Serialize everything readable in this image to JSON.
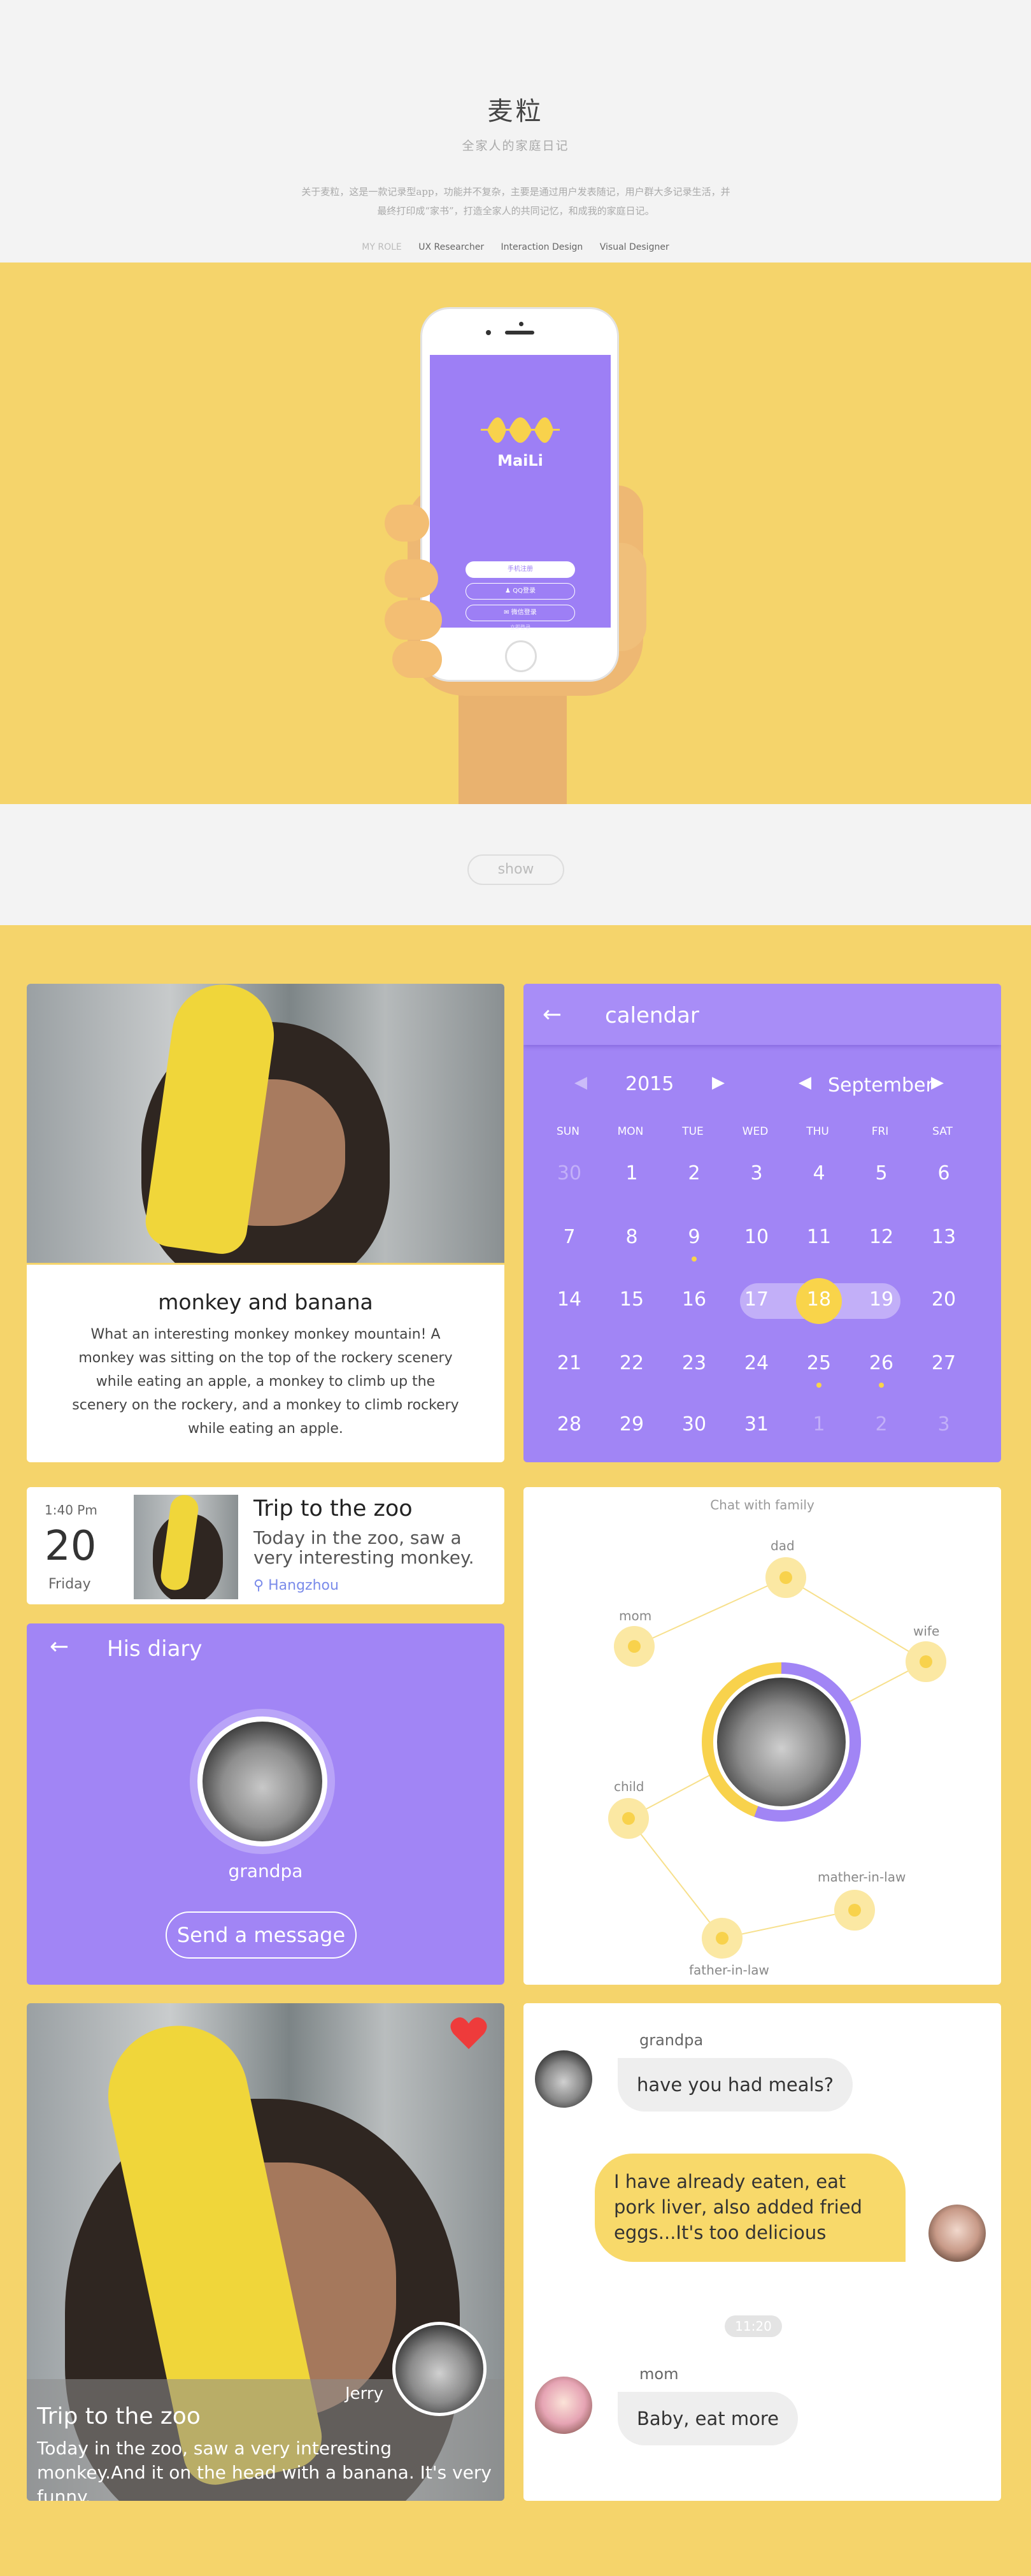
{
  "header": {
    "title": "麦粒",
    "subtitle": "全家人的家庭日记",
    "description": "关于麦粒，这是一款记录型app，功能并不复杂，主要是通过用户发表随记，用户群大多记录生活，并最终打印成“家书”，打造全家人的共同记忆，和成我的家庭日记。",
    "roles_label": "MY ROLE",
    "roles": [
      "UX Researcher",
      "Interaction Design",
      "Visual Designer"
    ]
  },
  "phone": {
    "app_name": "MaiLi",
    "phone_login": "手机注册",
    "qq_login": "QQ登录",
    "wechat_login": "微信登录",
    "footer_link": "立即登录"
  },
  "show_button": "show",
  "monkey_card": {
    "title": "monkey and banana",
    "text": "What an interesting monkey monkey mountain! A monkey was sitting on the top of the rockery scenery  while eating an apple, a monkey to climb up the scenery on the rockery, and a monkey to climb rockery while eating an apple."
  },
  "calendar": {
    "title": "calendar",
    "year": "2015",
    "month": "September",
    "weekdays": [
      "SUN",
      "MON",
      "TUE",
      "WED",
      "THU",
      "FRI",
      "SAT"
    ],
    "selected": "18",
    "range": [
      "17",
      "19"
    ],
    "rows": [
      [
        "30",
        "1",
        "2",
        "3",
        "4",
        "5",
        "6"
      ],
      [
        "7",
        "8",
        "9",
        "10",
        "11",
        "12",
        "13"
      ],
      [
        "14",
        "15",
        "16",
        "17",
        "18",
        "19",
        "20"
      ],
      [
        "21",
        "22",
        "23",
        "24",
        "25",
        "26",
        "27"
      ],
      [
        "28",
        "29",
        "30",
        "31",
        "1",
        "2",
        "3"
      ]
    ],
    "colors": {
      "accent": "#f9d44a",
      "bg": "#a185f5"
    }
  },
  "trip_card": {
    "time": "1:40 Pm",
    "day": "20",
    "weekday": "Friday",
    "title": "Trip to the zoo",
    "text": "Today in the zoo, saw a very interesting monkey.",
    "location": "Hangzhou"
  },
  "diary_card": {
    "title": "His diary",
    "name": "grandpa",
    "button": "Send a message"
  },
  "family_card": {
    "title": "Chat with family",
    "members": [
      "dad",
      "mom",
      "wife",
      "child",
      "mather-in-law",
      "father-in-law"
    ]
  },
  "photo_card": {
    "title": "Trip to the zoo",
    "author": "Jerry",
    "text": "Today in the zoo, saw a very interesting monkey.And it on the head with a banana. It's very funny."
  },
  "chat": {
    "m1_name": "grandpa",
    "m1_text": "have you had meals?",
    "m2_text": "I have already eaten, eat pork liver, also added fried eggs...It's too delicious",
    "time": "11:20",
    "m3_name": "mom",
    "m3_text": "Baby, eat more"
  },
  "colors": {
    "yellow": "#f5d46b",
    "purple": "#a185f5",
    "light": "#f3f3f3"
  }
}
